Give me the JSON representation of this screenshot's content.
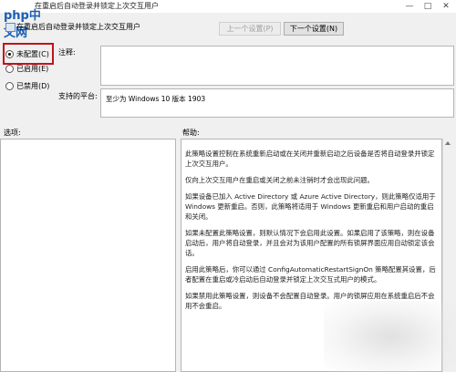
{
  "window": {
    "title": "在重启后自动登录并锁定上次交互用户"
  },
  "watermark": {
    "logo_text": "php中文网"
  },
  "header": {
    "policy_name": "在重启后自动登录并锁定上次交互用户",
    "prev_button": "上一个设置(P)",
    "next_button": "下一个设置(N)"
  },
  "state": {
    "options": [
      {
        "label": "未配置(C)",
        "selected": true
      },
      {
        "label": "已启用(E)",
        "selected": false
      },
      {
        "label": "已禁用(D)",
        "selected": false
      }
    ]
  },
  "comment": {
    "label": "注释:",
    "value": ""
  },
  "supported": {
    "label": "支持的平台:",
    "value": "至少为 Windows 10 版本 1903"
  },
  "options_section": {
    "label": "选项:"
  },
  "help_section": {
    "label": "帮助:",
    "paragraphs": [
      "此策略设置控制在系统重新启动或在关闭并重新启动之后设备是否将自动登录并锁定上次交互用户。",
      "仅向上次交互用户在重启或关闭之前未注销时才会出现此问题。",
      "如果设备已加入 Active Directory 或 Azure Active Directory，则此策略仅适用于 Windows 更新重启。否则，此策略将适用于 Windows 更新重启和用户启动的重启和关闭。",
      "如果未配置此策略设置，则默认情况下会启用此设置。如果启用了该策略，则在设备启动后，用户将自动登录，并且会对为该用户配置的所有锁屏界面应用自动锁定该会话。",
      "启用此策略后，你可以通过 ConfigAutomaticRestartSignOn 策略配置其设置，后者配置在重启或冷启动后自动登录并锁定上次交互式用户的模式。",
      "如果禁用此策略设置，则设备不会配置自动登录。用户的锁屏应用在系统重启后不会用不会重启。"
    ]
  },
  "colors": {
    "highlight_border": "#c0141c",
    "logo": "#1a5fb4"
  }
}
